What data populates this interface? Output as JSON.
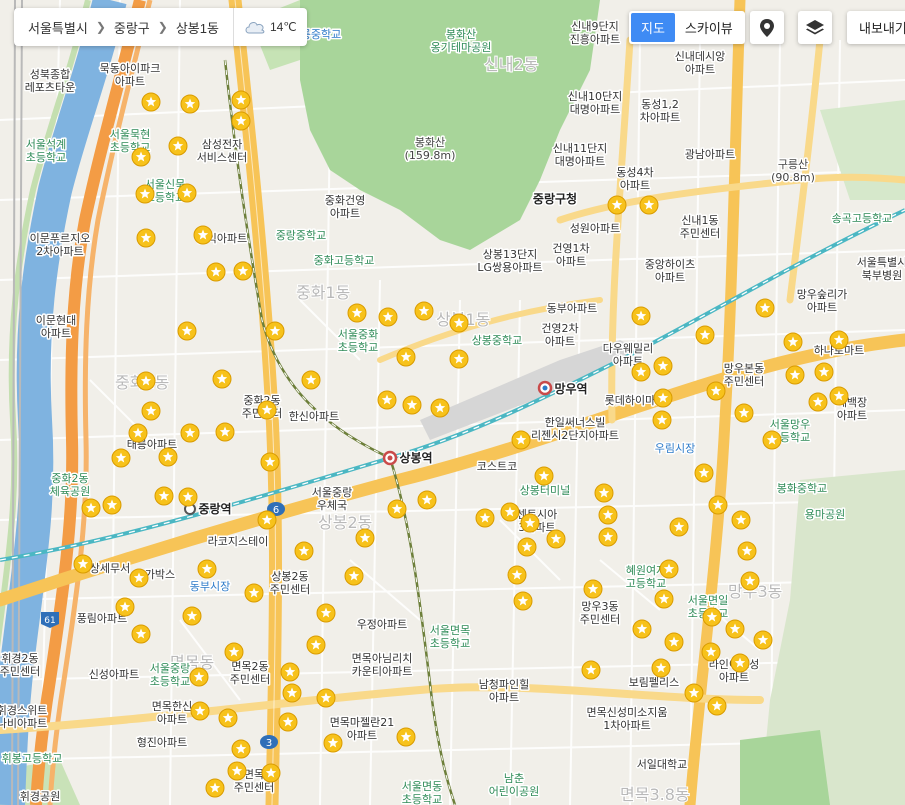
{
  "breadcrumb": {
    "items": [
      "서울특별시",
      "중랑구",
      "상봉1동"
    ],
    "temperature": "14℃"
  },
  "map_type": {
    "map_label": "지도",
    "sky_label": "스카이뷰",
    "active": "map"
  },
  "export_label": "내보내기",
  "icons": {
    "location": "location-pin-icon",
    "layers": "layers-icon",
    "weather": "cloud-icon"
  },
  "colors": {
    "accent": "#3f8bf4",
    "star": "#f7c21b",
    "park": "#a8d59a",
    "river": "#7fb3e0",
    "road_major": "#f7c457",
    "expressway": "#f39c45"
  },
  "map_labels": {
    "district_sinnae2": "신내2동",
    "district_junghwa1": "중화1동",
    "district_junghwa2": "중화2동",
    "district_sangbong1": "상봉1동",
    "district_sangbong2": "상봉2동",
    "district_myeonmok": "면목동",
    "district_mangu3": "망우3동",
    "district_myeonmok38": "면목3.8동",
    "taereung_ms": "태릉중학교",
    "bonghwasan_park": "봉화산\n옹기테마공원",
    "bonghwasan": "봉화산\n(159.8m)",
    "mukdong_apt": "묵동아이파크\n아파트",
    "seongbuk_lepo": "성북종합\n레포츠타운",
    "seoul_mukhyeon": "서울묵현\n초등학교",
    "samsung_center": "삼성전자\n서비스센터",
    "seoul_seokgye": "서울석계\n초등학교",
    "seoul_sinmuk": "서울신묵\n초등학교",
    "junghwa_geonyeong": "중화건영\n아파트",
    "junghwa_ms": "중랑중학교",
    "junghwa_hs": "중화고등학교",
    "samik_apt": "삼익아파트",
    "ium_apt": "이문푸르지오\n2차아파트",
    "imun_hyundai": "이문현대\n아파트",
    "sinnae9": "신내9단지\n진흥아파트",
    "sinnae10": "신내10단지\n대명아파트",
    "sinnae11": "신내11단지\n대명아파트",
    "sinnae_desian": "신내데시앙\n아파트",
    "dongseong12": "동성1,2\n차아파트",
    "dongseong4": "동성4차\n아파트",
    "gwangnam": "광남아파트",
    "gureungsan": "구릉산\n(90.8m)",
    "jungnang_office": "중랑구청",
    "seongwon": "성원아파트",
    "sinnae1_center": "신내1동\n주민센터",
    "songgok_hs": "송곡고등학교",
    "sangbong13": "상봉13단지\nLG쌍용아파트",
    "geonyeong1": "건영1차\n아파트",
    "junganghights": "중앙하이츠\n아파트",
    "seoul_bukbu": "서울특별시\n북부병원",
    "mangwoo_sup": "망우숲리가\n아파트",
    "dongbu_apt": "동부아파트",
    "geonyeong2": "건영2차\n아파트",
    "seoul_junghwa_es": "서울중화\n초등학교",
    "sangbong_ms": "상봉중학교",
    "dawaefamily": "다우웨밀리\n아파트",
    "mangwoobon": "망우본동\n주민센터",
    "hanaro": "하나로마트",
    "mangwoo_st": "망우역",
    "lotte_mart": "롯데하이마트",
    "sebaekjang": "세백장\n아파트",
    "junghwa2_center": "중화2동\n주민센터",
    "hanshin": "한신아파트",
    "sangbong_st": "상봉역",
    "hanil": "한일써너스빌\n리젠시2단지아파트",
    "costco": "코스트코",
    "uripsijang": "우림시장",
    "seoul_mangwoo_es": "서울망우\n초등학교",
    "taereung_apt": "태릉아파트",
    "junghwa2_gym": "중화2동\n체육공원",
    "seoul_post": "서울중랑\n우체국",
    "sangbong_terminal": "상봉터미널",
    "bonghwa_ms": "봉화중학교",
    "junghwa_st": "중랑역",
    "yongma_park": "용마공원",
    "daelim": "라코지스테이",
    "sangbong_center": "상봉2동\n주민센터",
    "dongbu_market": "동부시장",
    "sentia": "센트시아\n3아파트",
    "hyewon_hs": "혜원여자\n고등학교",
    "mangwoo3_center": "망우3동\n주민센터",
    "seoul_myeonil": "서울면일\n초등학교",
    "sangse": "상세무서",
    "gabaks": "가박스",
    "pungrim": "풍림아파트",
    "ujeong": "우정아파트",
    "myeonmok_es": "서울면목\n초등학교",
    "lines_apt": "라인이트성\n아파트",
    "hwigyeong2": "휘경2동\n주민센터",
    "sinseong": "신성아파트",
    "seoul_jungnang_es": "서울중랑\n초등학교",
    "myeonmok2_center": "면목2동\n주민센터",
    "myeonmok_richi": "면목아님리치\n카운티아파트",
    "namcheong": "남청파인힐\n아파트",
    "borim": "보림펠리스",
    "myeonmok_hyundai": "면목한신\n아파트",
    "hwigyeong_swit": "휘경스위트\n나비아파트",
    "hyeongjin": "형진아파트",
    "myeonmok_majel": "면목마젤란21\n아파트",
    "myeonmok_sinseong": "면목신성미소지움\n1차아파트",
    "hwigyeong_hs": "휘봉고등학교",
    "myeonmok_center": "면목\n주민센터",
    "seoul_myeonmok_es": "서울면동\n초등학교",
    "namchun_park": "남춘\n어린이공원",
    "seoil_univ": "서일대학교",
    "hwigyeong_park": "휘경공원"
  },
  "route_badges": {
    "r6": "6",
    "r3": "3",
    "r61": "61"
  }
}
